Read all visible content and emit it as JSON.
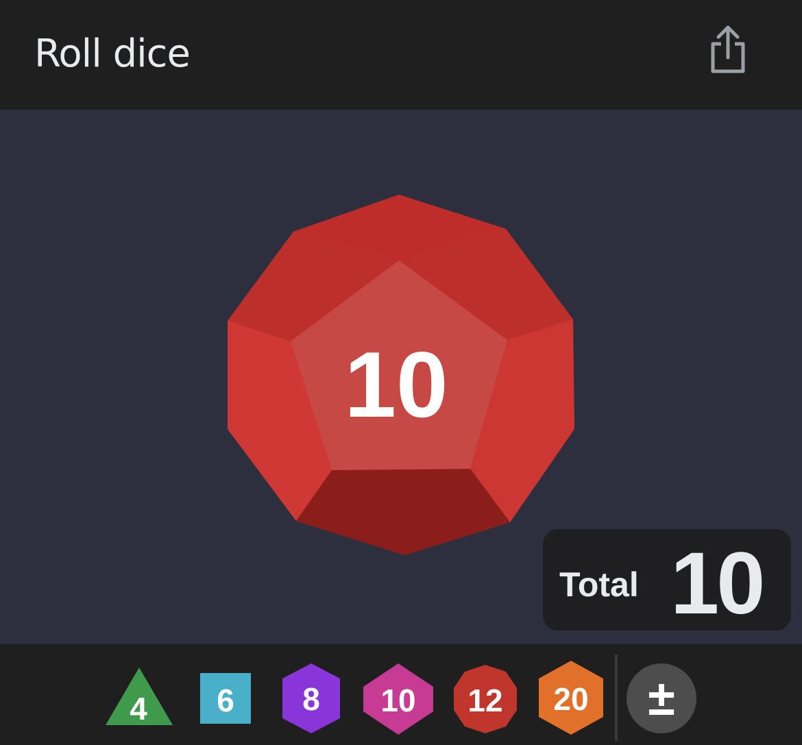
{
  "header": {
    "title": "Roll dice"
  },
  "main_die": {
    "type": "d12",
    "value": "10",
    "color": "#c0302c"
  },
  "total": {
    "label": "Total",
    "value": "10"
  },
  "dice_buttons": [
    {
      "sides": "4",
      "shape": "triangle",
      "color": "#3f9a4c"
    },
    {
      "sides": "6",
      "shape": "square",
      "color": "#4ab0c9"
    },
    {
      "sides": "8",
      "shape": "hexagon",
      "color": "#8a35d9"
    },
    {
      "sides": "10",
      "shape": "hexagon-wide",
      "color": "#c73b94"
    },
    {
      "sides": "12",
      "shape": "decagon",
      "color": "#c0362c"
    },
    {
      "sides": "20",
      "shape": "hexagon",
      "color": "#e0702a"
    }
  ],
  "modifier_button": {
    "label": "±"
  },
  "icons": {
    "share": "share-icon"
  }
}
